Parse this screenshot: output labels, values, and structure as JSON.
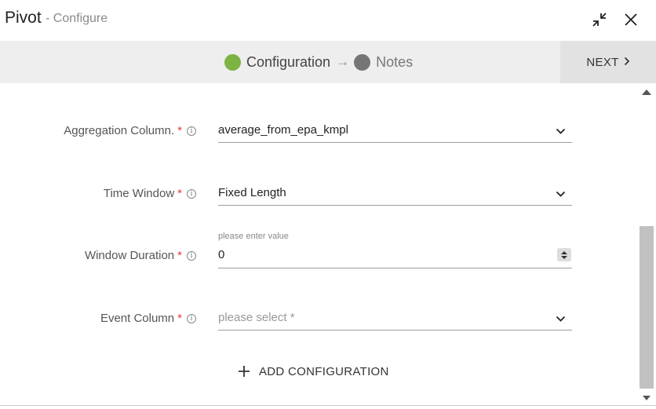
{
  "header": {
    "title": "Pivot",
    "subtitle": "- Configure",
    "minimize_icon": "collapse-icon",
    "close_icon": "close-icon"
  },
  "stepper": {
    "steps": [
      {
        "label": "Configuration",
        "status": "active",
        "color": "#7cb342"
      },
      {
        "label": "Notes",
        "status": "inactive",
        "color": "#757575"
      }
    ],
    "arrow": "→",
    "next_label": "NEXT",
    "next_chevron": "›"
  },
  "form": {
    "aggregation_column": {
      "label": "Aggregation Column.",
      "required": "*",
      "value": "average_from_epa_kmpl"
    },
    "time_window": {
      "label": "Time Window",
      "required": "*",
      "value": "Fixed Length"
    },
    "window_duration": {
      "label": "Window Duration",
      "required": "*",
      "hint": "please enter value",
      "value": "0"
    },
    "event_column": {
      "label": "Event Column",
      "required": "*",
      "placeholder": "please select *"
    },
    "add_configuration_label": "ADD CONFIGURATION",
    "info_glyph": "i"
  },
  "colors": {
    "accent_active": "#7cb342",
    "required": "#e53935"
  }
}
